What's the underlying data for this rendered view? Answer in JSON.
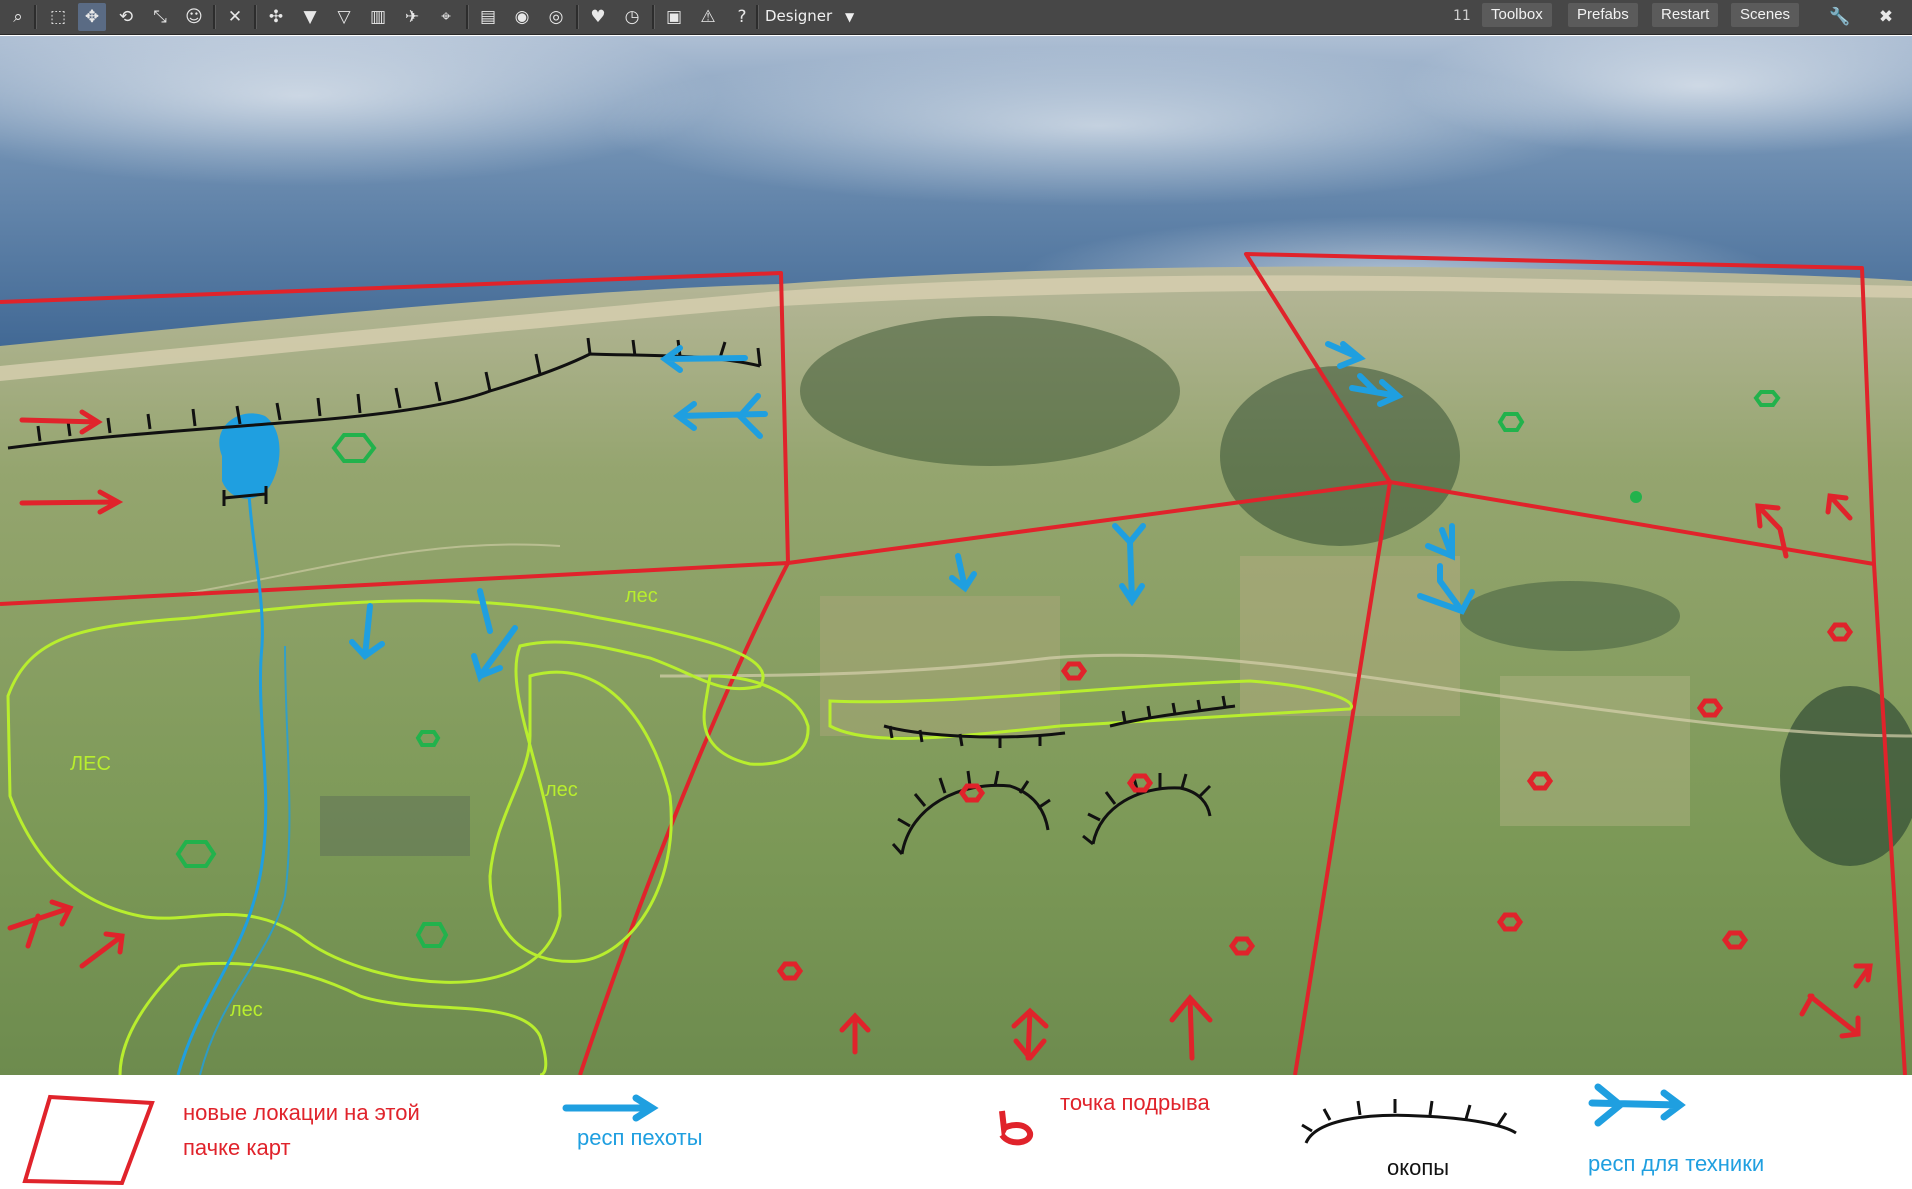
{
  "toolbar": {
    "mode_label": "Designer",
    "counter": "11",
    "buttons": [
      "Toolbox",
      "Prefabs",
      "Restart",
      "Scenes"
    ]
  },
  "map": {
    "forest_labels": [
      "лес",
      "ЛЕС",
      "лес",
      "лес"
    ]
  },
  "legend": {
    "new_locations": [
      "новые локации на этой",
      "пачке карт"
    ],
    "infantry_spawn": "респ пехоты",
    "blast_point": "точка подрыва",
    "trenches": "окопы",
    "vehicle_spawn": "респ для техники"
  },
  "colors": {
    "zone_border": "#e0232b",
    "infantry": "#1f9fe0",
    "forest_outline": "#b8ee2e",
    "trench": "#111111",
    "hex_marker": "#22b24c"
  }
}
